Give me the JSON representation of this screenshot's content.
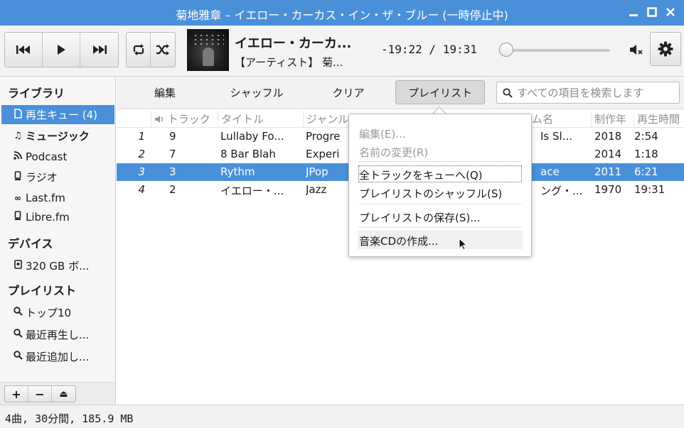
{
  "window": {
    "title": "菊地雅章  –  イエロー・カーカス・イン・ザ・ブルー (一時停止中)"
  },
  "player": {
    "track_title": "イエロー・カーカ...",
    "track_artist": "【アーティスト】 菊...",
    "time": "-19:22 / 19:31",
    "progress": 0.0
  },
  "sidebar": {
    "library_header": "ライブラリ",
    "library_items": [
      {
        "label": "再生キュー (4)",
        "icon": "file-icon"
      },
      {
        "label": "ミュージック",
        "icon": "music-note-icon"
      },
      {
        "label": "Podcast",
        "icon": "rss-icon"
      },
      {
        "label": "ラジオ",
        "icon": "radio-icon"
      },
      {
        "label": "Last.fm",
        "icon": "lastfm-icon"
      },
      {
        "label": "Libre.fm",
        "icon": "radio-icon"
      }
    ],
    "devices_header": "デバイス",
    "device_items": [
      {
        "label": "320 GB ボ...",
        "icon": "drive-icon"
      }
    ],
    "playlists_header": "プレイリスト",
    "playlist_items": [
      {
        "label": "トップ10",
        "icon": "search-icon"
      },
      {
        "label": "最近再生し...",
        "icon": "search-icon"
      },
      {
        "label": "最近追加し...",
        "icon": "search-icon"
      }
    ],
    "bottom_buttons": [
      "+",
      "−",
      "⏏"
    ]
  },
  "tabs": {
    "edit": "編集",
    "shuffle": "シャッフル",
    "clear": "クリア",
    "playlist": "プレイリスト"
  },
  "search": {
    "placeholder": "すべての項目を検索します"
  },
  "table": {
    "headers": {
      "track": "トラック",
      "title": "タイトル",
      "genre": "ジャンル",
      "album": "ム名",
      "year": "制作年",
      "length": "再生時間"
    },
    "rows": [
      {
        "num": "1",
        "track": "9",
        "title": "Lullaby Fo...",
        "genre": "Progre",
        "album": "Is Sl...",
        "year": "2018",
        "length": "2:54"
      },
      {
        "num": "2",
        "track": "7",
        "title": "8 Bar Blah",
        "genre": "Experi",
        "album": "",
        "year": "2014",
        "length": "1:18"
      },
      {
        "num": "3",
        "track": "3",
        "title": "Rythm",
        "genre": "JPop",
        "album": "ace",
        "year": "2011",
        "length": "6:21"
      },
      {
        "num": "4",
        "track": "2",
        "title": "イエロー・...",
        "genre": "Jazz",
        "album": "ング・...",
        "year": "1970",
        "length": "19:31"
      }
    ]
  },
  "menu": {
    "edit": "編集(E)...",
    "rename": "名前の変更(R)",
    "queue_all": "全トラックをキューへ(Q)",
    "shuffle_playlist": "プレイリストのシャッフル(S)",
    "save_playlist": "プレイリストの保存(S)...",
    "burn_cd": "音楽CDの作成..."
  },
  "status": {
    "summary": "4曲, 30分間, 185.9 MB"
  },
  "colors": {
    "accent": "#4a90d9"
  }
}
